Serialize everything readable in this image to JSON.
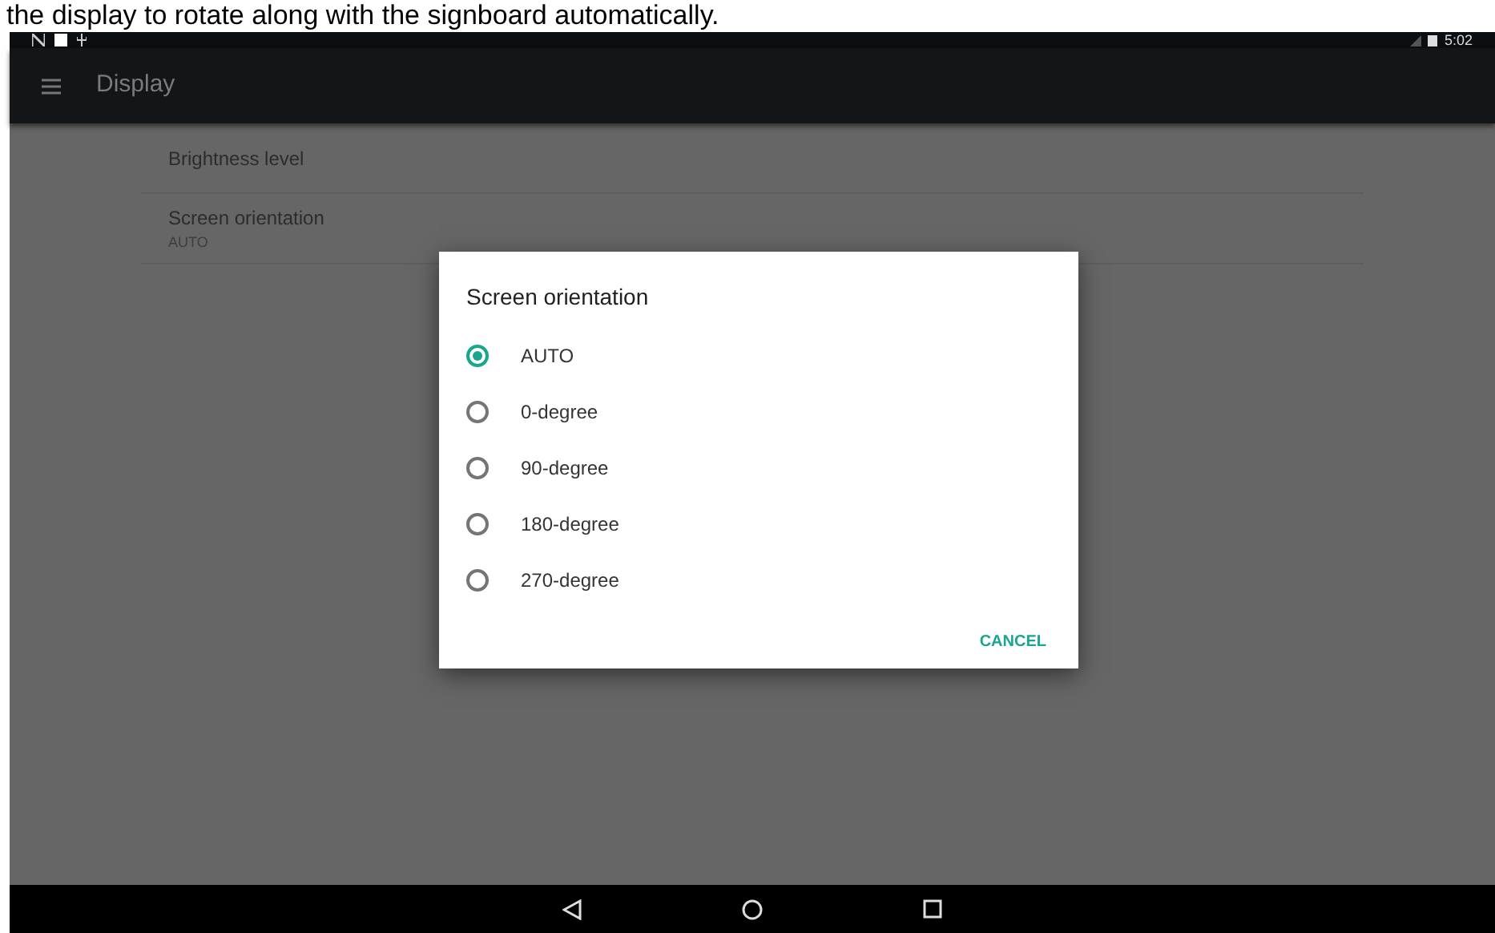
{
  "caption": "the display to rotate along with the signboard automatically.",
  "status_bar": {
    "time": "5:02"
  },
  "toolbar": {
    "title": "Display"
  },
  "settings": [
    {
      "title": "Brightness level"
    },
    {
      "title": "Screen orientation",
      "summary": "AUTO"
    }
  ],
  "dialog": {
    "title": "Screen orientation",
    "options": [
      {
        "label": "AUTO",
        "selected": true
      },
      {
        "label": "0-degree",
        "selected": false
      },
      {
        "label": "90-degree",
        "selected": false
      },
      {
        "label": "180-degree",
        "selected": false
      },
      {
        "label": "270-degree",
        "selected": false
      }
    ],
    "buttons": [
      "CANCEL"
    ]
  }
}
